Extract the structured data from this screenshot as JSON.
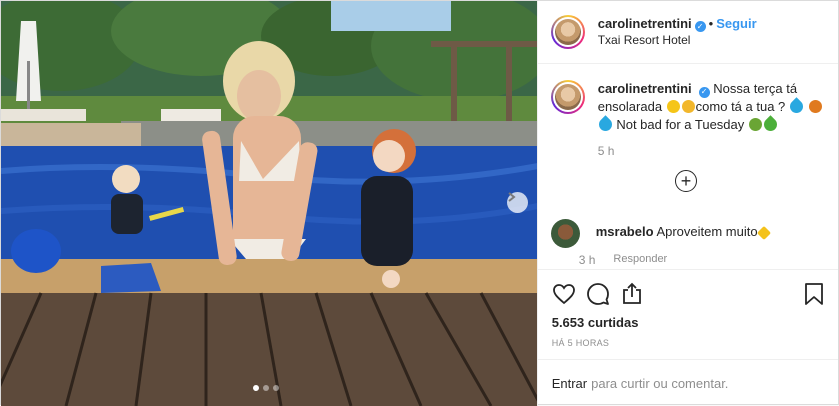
{
  "header": {
    "username": "carolinetrentini",
    "follow_label": "Seguir",
    "location": "Txai Resort Hotel",
    "separator": "•"
  },
  "caption": {
    "username": "carolinetrentini",
    "text_part1": "Nossa terça tá ensolarada",
    "text_part2": "como tá a tua ?",
    "text_part3": "Not bad for a Tuesday",
    "time": "5 h"
  },
  "load_more": {
    "label": "+"
  },
  "comment": {
    "username": "msrabelo",
    "text": "Aproveitem muito",
    "time": "3 h",
    "reply_label": "Responder"
  },
  "actions": {
    "like_icon": "heart-icon",
    "comment_icon": "comment-icon",
    "share_icon": "share-icon",
    "save_icon": "bookmark-icon"
  },
  "likes": {
    "text": "5.653 curtidas"
  },
  "posted": {
    "text": "HÁ 5 HORAS"
  },
  "login": {
    "link": "Entrar",
    "text": "para curtir ou comentar."
  },
  "carousel": {
    "total": 3,
    "current": 1
  },
  "colors": {
    "accent": "#3897f0",
    "text": "#262626",
    "muted": "#8e8e8e",
    "border": "#efefef"
  }
}
